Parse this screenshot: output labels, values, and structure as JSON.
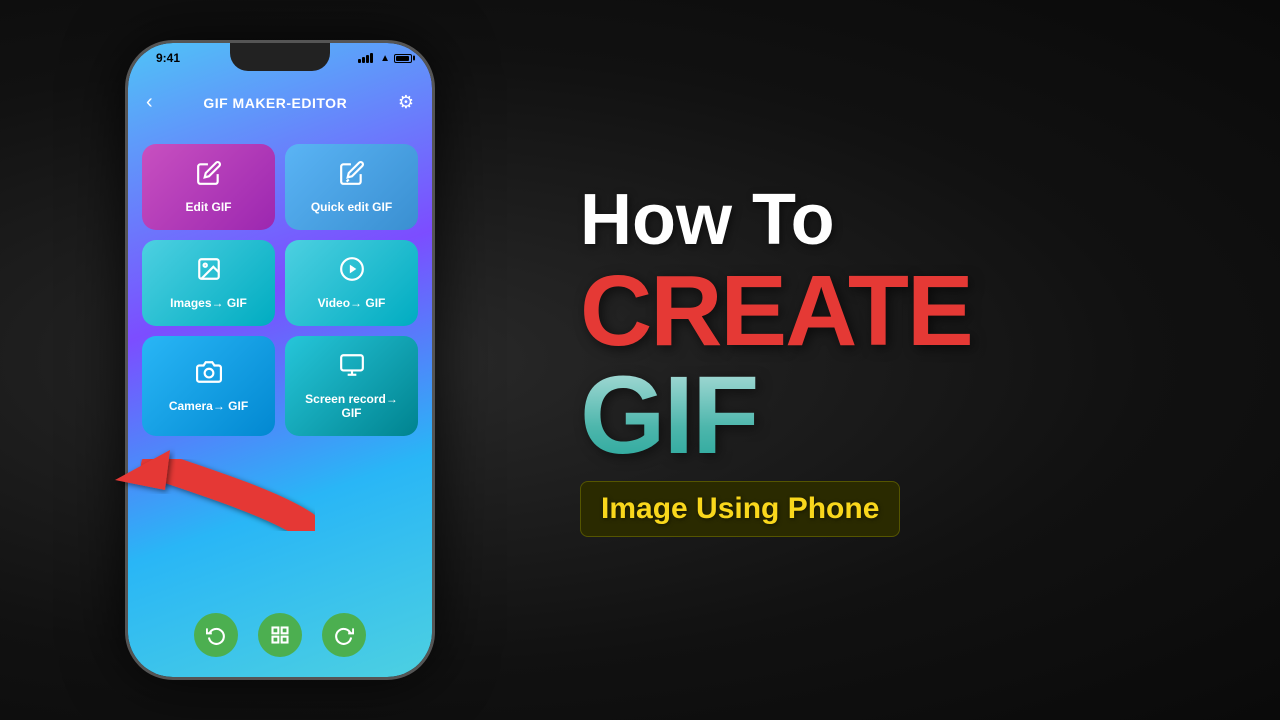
{
  "background": {
    "color": "#1a1a1a"
  },
  "phone": {
    "status_bar": {
      "time": "9:41"
    },
    "header": {
      "back_icon": "‹",
      "title": "GIF MAKER-EDITOR",
      "settings_icon": "⚙"
    },
    "buttons": [
      {
        "id": "edit-gif",
        "label": "Edit GIF",
        "icon": "✏",
        "style": "purple"
      },
      {
        "id": "quick-edit-gif",
        "label": "Quick edit GIF",
        "icon": "✏",
        "style": "blue-light"
      },
      {
        "id": "images-to-gif",
        "label": "Images→ GIF",
        "icon": "🖼",
        "style": "blue-medium"
      },
      {
        "id": "video-to-gif",
        "label": "Video→ GIF",
        "icon": "▷",
        "style": "blue-medium"
      },
      {
        "id": "camera-to-gif",
        "label": "Camera→ GIF",
        "icon": "📷",
        "style": "teal"
      },
      {
        "id": "screen-record-to-gif",
        "label": "Screen record→ GIF",
        "icon": "⏺",
        "style": "teal"
      }
    ],
    "bottom_nav": [
      {
        "id": "nav1",
        "icon": "↺"
      },
      {
        "id": "nav2",
        "icon": "⊡"
      },
      {
        "id": "nav3",
        "icon": "↻"
      }
    ]
  },
  "right_content": {
    "line1": "How To",
    "line2": "CREATE",
    "line3": "GIF",
    "subtitle": "Image Using Phone"
  }
}
